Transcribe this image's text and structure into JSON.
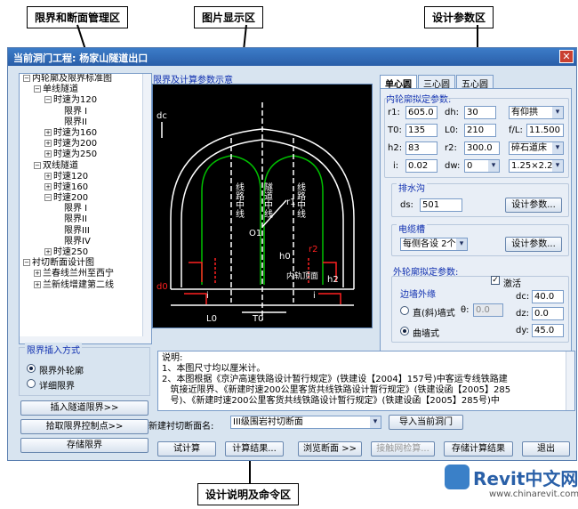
{
  "callouts": {
    "tree_area": "限界和断面管理区",
    "image_area": "图片显示区",
    "param_area": "设计参数区",
    "command_area": "设计说明及命令区"
  },
  "window": {
    "title": "当前洞门工程: 杨家山隧道出口",
    "close_icon": "✕"
  },
  "tree": {
    "rows": [
      {
        "indent": 0,
        "exp": "−",
        "label": "内轮廓及限界标准图"
      },
      {
        "indent": 1,
        "exp": "−",
        "label": "单线隧道"
      },
      {
        "indent": 2,
        "exp": "−",
        "label": "时速为120"
      },
      {
        "indent": 3,
        "exp": "",
        "label": "限界 I"
      },
      {
        "indent": 3,
        "exp": "",
        "label": "限界II"
      },
      {
        "indent": 2,
        "exp": "+",
        "label": "时速为160"
      },
      {
        "indent": 2,
        "exp": "+",
        "label": "时速为200"
      },
      {
        "indent": 2,
        "exp": "+",
        "label": "时速为250"
      },
      {
        "indent": 1,
        "exp": "−",
        "label": "双线隧道"
      },
      {
        "indent": 2,
        "exp": "+",
        "label": "时速120"
      },
      {
        "indent": 2,
        "exp": "+",
        "label": "时速160"
      },
      {
        "indent": 2,
        "exp": "−",
        "label": "时速200"
      },
      {
        "indent": 3,
        "exp": "",
        "label": "限界 I"
      },
      {
        "indent": 3,
        "exp": "",
        "label": "限界II"
      },
      {
        "indent": 3,
        "exp": "",
        "label": "限界III"
      },
      {
        "indent": 3,
        "exp": "",
        "label": "限界IV"
      },
      {
        "indent": 2,
        "exp": "+",
        "label": "时速250"
      },
      {
        "indent": 0,
        "exp": "−",
        "label": "衬切断面设计图"
      },
      {
        "indent": 1,
        "exp": "+",
        "label": "兰春线兰州至西宁"
      },
      {
        "indent": 1,
        "exp": "+",
        "label": "兰新线增建第二线"
      }
    ]
  },
  "canvas": {
    "label": "限界及计算参数示意",
    "texts": {
      "dc": "dc",
      "left_line": "线路中线",
      "center_line": "隧道中线",
      "right_line": "线路中线",
      "o1": "O1",
      "r1": "r1",
      "h0": "h0",
      "h2": "h2",
      "inner_rail": "内轨顶面",
      "r2": "r2",
      "t0": "T0",
      "l0": "L0",
      "d0": "d0",
      "i_left": "i",
      "i_right": "i"
    }
  },
  "tabs": [
    "单心圆",
    "三心圆",
    "五心圆"
  ],
  "inner": {
    "title": "内轮廓拟定参数:",
    "r1_label": "r1:",
    "r1": "605.0",
    "dh_label": "dh:",
    "dh": "30",
    "invert": "有仰拱",
    "t0_label": "T0:",
    "t0": "135",
    "l0_label": "L0:",
    "l0": "210",
    "fl_label": "f/L:",
    "fl": "11.500",
    "h2_label": "h2:",
    "h2": "83",
    "r2_label": "r2:",
    "r2": "300.0",
    "ballast": "碎石道床",
    "i_label": "i:",
    "i": "0.02",
    "dw_label": "dw:",
    "dw": "0",
    "size": "1.25×2.20"
  },
  "drain": {
    "title": "排水沟",
    "ds_label": "ds:",
    "ds": "501",
    "btn": "设计参数..."
  },
  "cable": {
    "title": "电缆槽",
    "select": "每侧各设 2个",
    "btn": "设计参数..."
  },
  "outer": {
    "title": "外轮廓拟定参数:",
    "activate": "激活",
    "check": "✓",
    "edge_title": "边墙外缘",
    "straight": "直(斜)墙式",
    "theta_label": "θ:",
    "theta": "0.0",
    "curved": "曲墙式",
    "dc_label": "dc:",
    "dc": "40.0",
    "dz_label": "dz:",
    "dz": "0.0",
    "dy_label": "dy:",
    "dy": "45.0"
  },
  "insert": {
    "title": "限界插入方式",
    "opt1": "限界外轮廓",
    "opt2": "详细限界"
  },
  "left_buttons": {
    "insert": "插入隧道限界>>",
    "pick": "拾取限界控制点>>",
    "store": "存储限界"
  },
  "desc": {
    "lines": [
      "说明:",
      "1、本图尺寸均以厘米计。",
      "2、本图根据《京沪高速铁路设计暂行规定》(铁建设【2004】157号)中客运专线铁路建",
      "   筑接近限界、《新建时速200公里客货共线铁路设计暂行规定》(铁建设函【2005】285",
      "   号)、《新建时速200公里客货共线铁路设计暂行规定》(铁建设函【2005】285号)中"
    ]
  },
  "section": {
    "label": "新建衬切断面名:",
    "value": "III级围岩衬切断面",
    "import_btn": "导入当前洞门"
  },
  "bottom_buttons": {
    "trial": "试计算",
    "result": "计算结果...",
    "browse": "浏览断面 >>",
    "contact": "接触网检算...",
    "save": "存储计算结果",
    "exit": "退出"
  },
  "watermark": {
    "brand": "Revit中文网",
    "url": "www.chinarevit.com"
  },
  "colors": {
    "window_bg": "#d8e4f0",
    "title_bar": "#2a5ea8",
    "canvas_bg": "#000000",
    "canvas_white": "#ffffff",
    "canvas_green": "#00c000",
    "canvas_red": "#ff2020",
    "accent_blue": "#1030b0"
  }
}
